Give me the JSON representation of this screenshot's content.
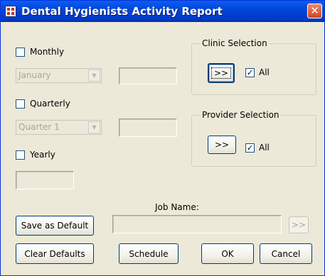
{
  "window": {
    "title": "Dental Hygienists Activity Report",
    "close_label": "✕"
  },
  "monthly": {
    "label": "Monthly",
    "checked": false,
    "combo_value": "January",
    "arrow": "▼"
  },
  "quarterly": {
    "label": "Quarterly",
    "checked": false,
    "combo_value": "Quarter 1",
    "arrow": "▼"
  },
  "yearly": {
    "label": "Yearly",
    "checked": false
  },
  "clinic_selection": {
    "title": "Clinic Selection",
    "button_label": ">>",
    "all_label": "All",
    "all_check_mark": "✓",
    "all_checked": true
  },
  "provider_selection": {
    "title": "Provider Selection",
    "button_label": ">>",
    "all_label": "All",
    "all_check_mark": "✓",
    "all_checked": true
  },
  "job": {
    "label": "Job Name:",
    "value": "",
    "browse_label": ">>"
  },
  "buttons": {
    "save_default": "Save as Default",
    "clear_defaults": "Clear Defaults",
    "schedule": "Schedule",
    "ok": "OK",
    "cancel": "Cancel"
  },
  "colors": {
    "title_bar": "#0246d9",
    "face": "#ece9d8",
    "close": "#d3451f"
  }
}
